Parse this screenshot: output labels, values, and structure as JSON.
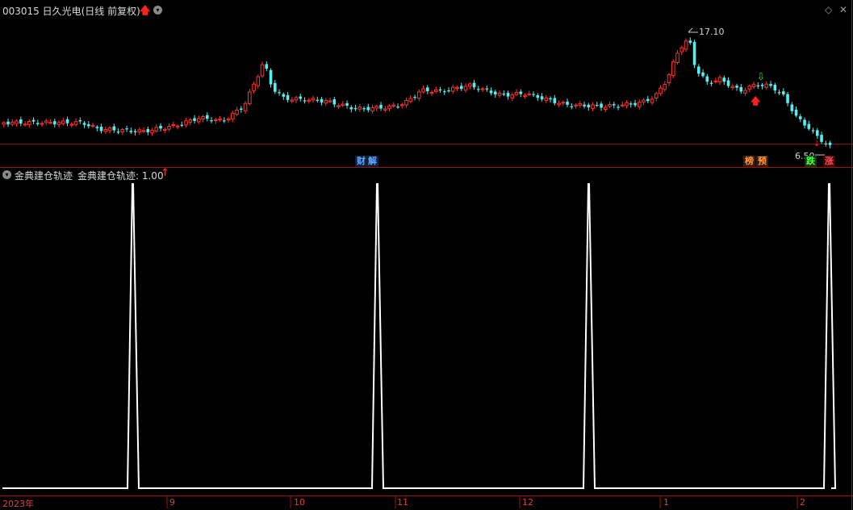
{
  "header": {
    "title": "003015 日久光电(日线 前复权)",
    "up_arrow": "up-arrow-icon",
    "dropdown_icon": "chevron-down-icon",
    "diamond_icon": "diamond-icon",
    "close_icon": "close-icon"
  },
  "price_chart": {
    "high_label": "17.10",
    "low_label": "6.50",
    "markers": {
      "finance": [
        "财",
        "解"
      ],
      "events": [
        "榜",
        "预"
      ],
      "bottom": [
        "跌",
        "涨"
      ]
    }
  },
  "indicator": {
    "name": "金典建仓轨迹",
    "value_label": "金典建仓轨迹: 1.00",
    "value_arrow": "↑",
    "spikes_at_candles": [
      43,
      125,
      197,
      278
    ]
  },
  "xaxis": {
    "labels": [
      "2023年",
      "9",
      "10",
      "11",
      "12",
      "1",
      "2"
    ]
  },
  "colors": {
    "up": "#ff3030",
    "down": "#54f0f0",
    "axis": "#a01010",
    "spike_line": "#ffffff"
  }
}
